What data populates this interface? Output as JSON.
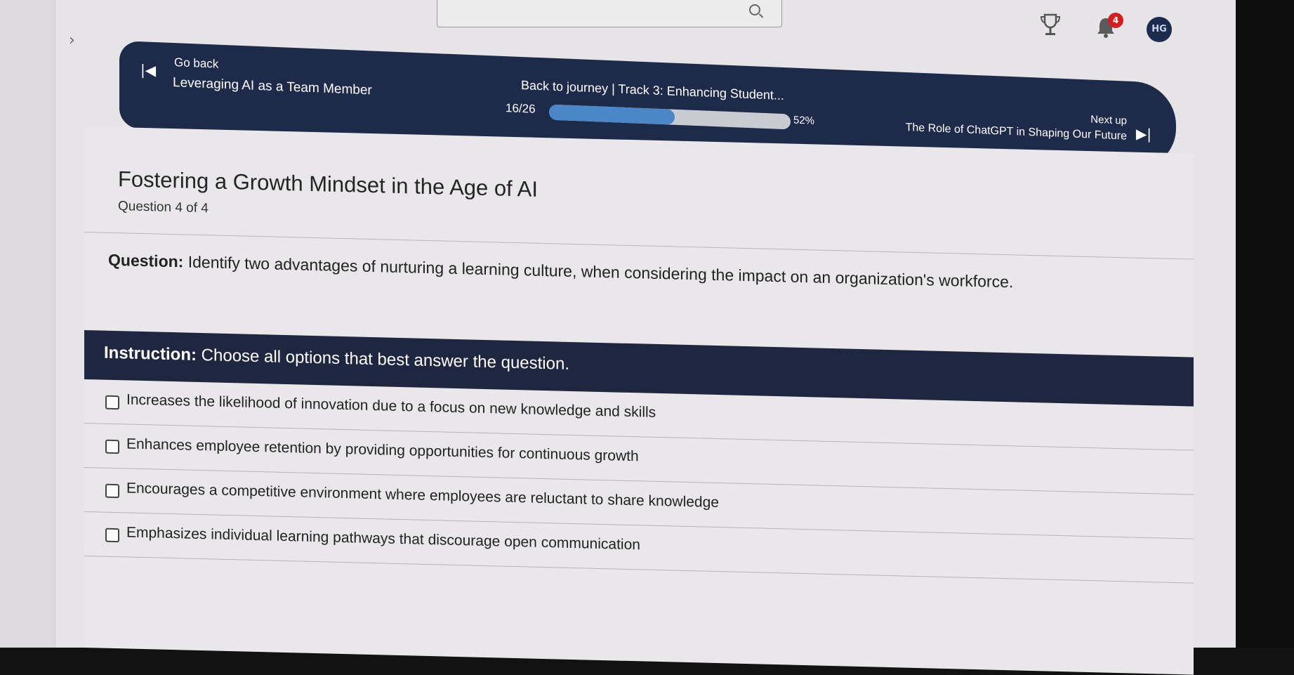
{
  "header": {
    "notification_count": "4",
    "avatar_initials": "HG"
  },
  "nav": {
    "go_back_label": "Go back",
    "previous_title": "Leveraging AI as a Team Member",
    "journey_label": "Back to journey  |  Track 3: Enhancing Student...",
    "progress_count": "16/26",
    "progress_percent_label": "52%",
    "progress_value": 0.52,
    "next_up_label": "Next up",
    "next_title": "The Role of ChatGPT in Shaping Our Future"
  },
  "quiz": {
    "title": "Fostering a Growth Mindset in the Age of AI",
    "question_counter": "Question 4 of 4",
    "question_prefix": "Question:",
    "question_text": " Identify two advantages of nurturing a learning culture, when considering the impact on an organization's workforce.",
    "instruction_prefix": "Instruction:",
    "instruction_text": " Choose all options that best answer the question.",
    "options": [
      "Increases the likelihood of innovation due to a focus on new knowledge and skills",
      "Enhances employee retention by providing opportunities for continuous growth",
      "Encourages a competitive environment where employees are reluctant to share knowledge",
      "Emphasizes individual learning pathways that discourage open communication"
    ]
  },
  "colors": {
    "nav_background": "#1e2a4a",
    "progress_fill": "#4a86c8",
    "instruction_background": "#1f2740",
    "badge": "#d31f1f"
  }
}
